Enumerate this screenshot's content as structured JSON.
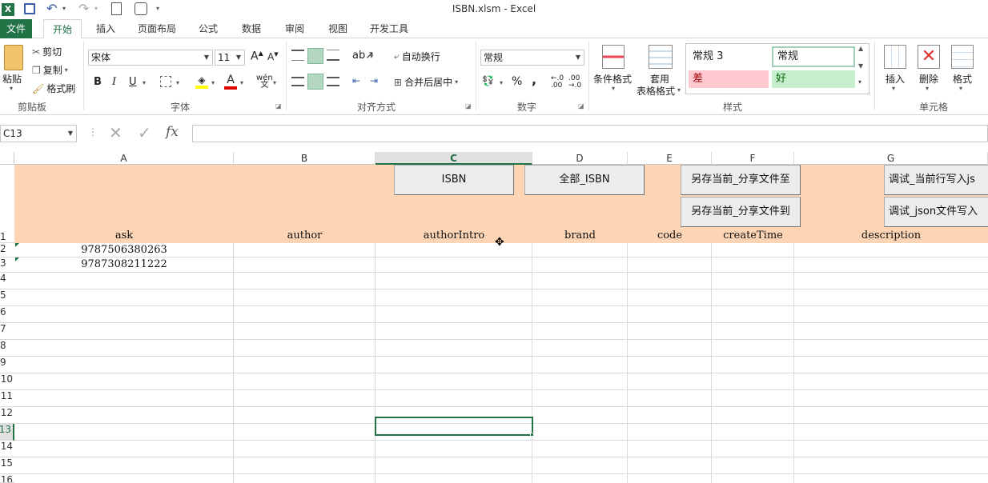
{
  "window": {
    "title": "ISBN.xlsm - Excel"
  },
  "tabs": [
    "文件",
    "开始",
    "插入",
    "页面布局",
    "公式",
    "数据",
    "审阅",
    "视图",
    "开发工具"
  ],
  "ribbon": {
    "clipboard": {
      "paste": "粘贴",
      "cut": "剪切",
      "copy": "复制",
      "painter": "格式刷",
      "label": "剪贴板"
    },
    "font": {
      "name": "宋体",
      "size": "11",
      "label": "字体",
      "bold": "B",
      "italic": "I",
      "underline": "U"
    },
    "align": {
      "wrap": "自动换行",
      "merge": "合并后居中",
      "label": "对齐方式"
    },
    "number": {
      "format": "常规",
      "percent": "%",
      "comma": ",",
      "label": "数字"
    },
    "styles": {
      "cond": "条件格式",
      "table_1": "套用",
      "table_2": "表格格式",
      "s1": "常规 3",
      "s2": "常规",
      "s3": "差",
      "s4": "好",
      "label": "样式"
    },
    "cells": {
      "insert": "插入",
      "delete": "删除",
      "format": "格式",
      "label": "单元格"
    }
  },
  "formula_bar": {
    "name_box": "C13",
    "fx": "fx",
    "value": ""
  },
  "columns": [
    "A",
    "B",
    "C",
    "D",
    "E",
    "F",
    "G"
  ],
  "rows": [
    "1",
    "2",
    "3",
    "4",
    "5",
    "6",
    "7",
    "8",
    "9",
    "10",
    "11",
    "12",
    "13",
    "14",
    "15",
    "16"
  ],
  "headers": [
    "ask",
    "author",
    "authorIntro",
    "brand",
    "code",
    "createTime",
    "description"
  ],
  "cells": {
    "A2": "9787506380263",
    "A3": "9787308211222"
  },
  "buttons": {
    "isbn": "ISBN",
    "all_isbn": "全部_ISBN",
    "save_to": "另存当前_分享文件至",
    "save_to2": "另存当前_分享文件到",
    "debug_row": "调试_当前行写入js",
    "debug_json": "调试_json文件写入"
  },
  "colors": {
    "header_fill": "#fdd5b4",
    "accent": "#217346",
    "bad_fill": "#ffc7ce",
    "good_fill": "#c6efce"
  }
}
